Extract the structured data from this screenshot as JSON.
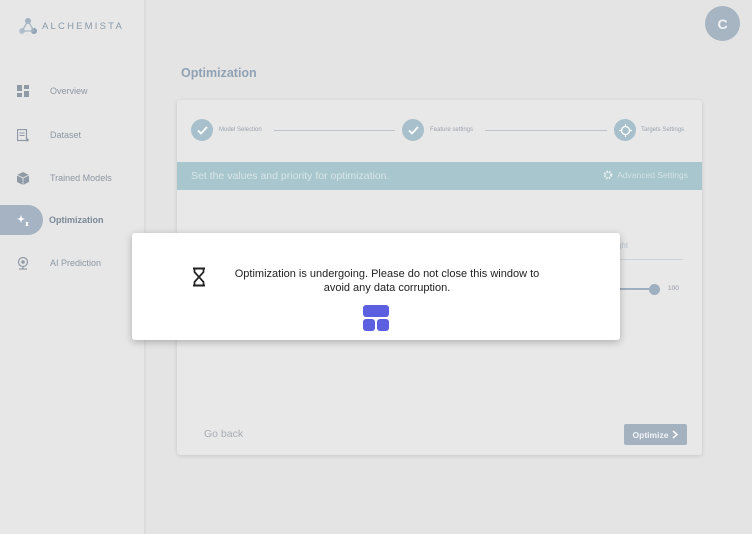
{
  "brand": {
    "name": "ALCHEMISTA"
  },
  "sidebar": {
    "items": [
      {
        "label": "Overview",
        "icon": "dashboard-icon"
      },
      {
        "label": "Dataset",
        "icon": "dataset-icon"
      },
      {
        "label": "Trained Models",
        "icon": "cube-icon"
      },
      {
        "label": "Optimization",
        "icon": "sparkle-icon",
        "active": true
      },
      {
        "label": "AI Prediction",
        "icon": "webcam-icon"
      }
    ]
  },
  "header": {
    "avatar_initial": "C"
  },
  "page": {
    "title": "Optimization"
  },
  "stepper": {
    "steps": [
      {
        "label": "Model Selection",
        "status": "done"
      },
      {
        "label": "Feature settings",
        "status": "done"
      },
      {
        "label": "Targets Settings",
        "status": "current"
      }
    ]
  },
  "banner": {
    "text": "Set the values and priority for optimization.",
    "advanced_label": "Advanced Settings"
  },
  "background_form": {
    "partial_header": "ght",
    "slider_value": "100"
  },
  "actions": {
    "go_back": "Go back",
    "optimize": "Optimize"
  },
  "modal": {
    "message": "Optimization is undergoing. Please do not close this window to avoid any data corruption.",
    "icon": "hourglass-icon"
  },
  "colors": {
    "accent": "#a7c6cd",
    "sidebar_active": "#a5b3c2",
    "loader": "#5b5fe0"
  }
}
